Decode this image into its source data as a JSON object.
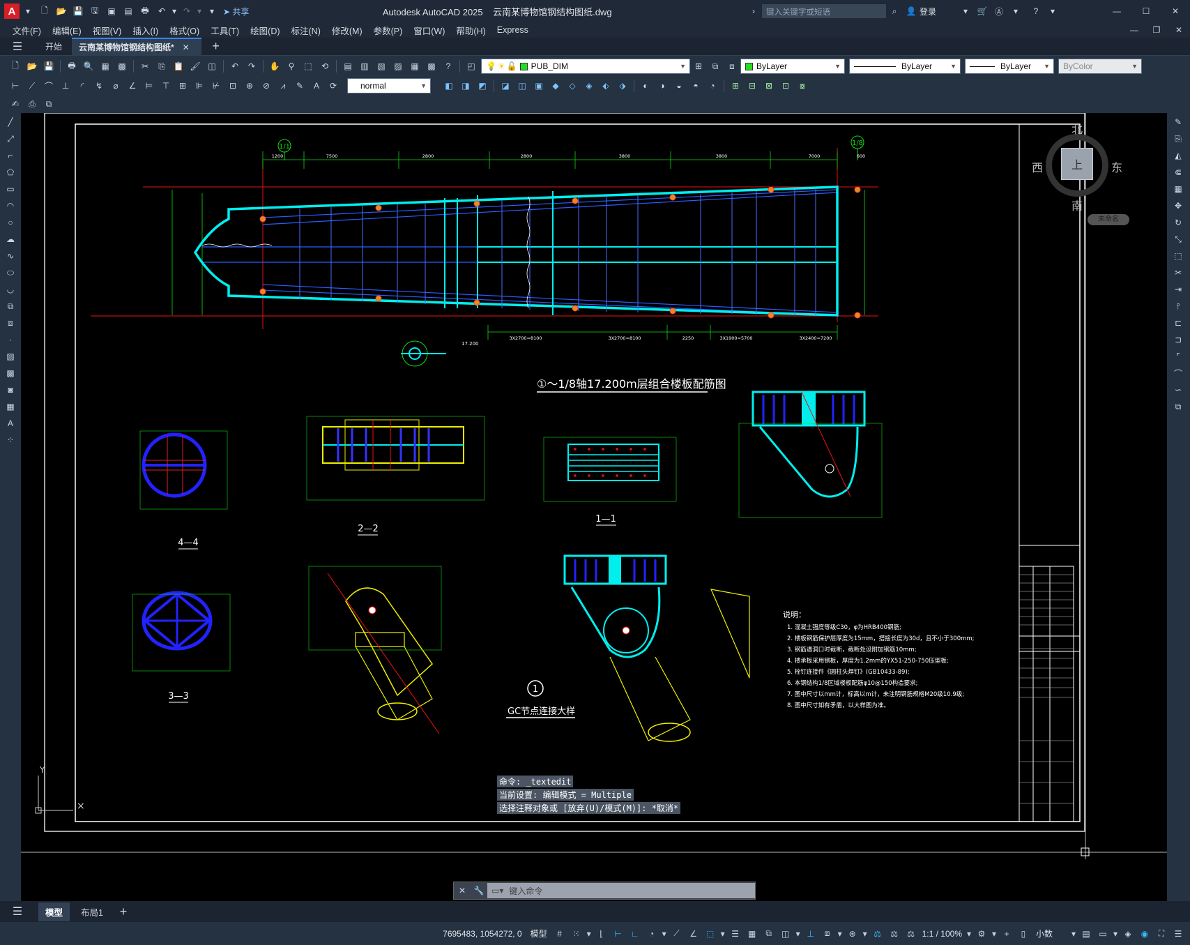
{
  "app": {
    "badge": "A",
    "title": "Autodesk AutoCAD 2025",
    "document": "云南某博物馆钢结构图纸.dwg",
    "share": "共享",
    "search_placeholder": "键入关键字或短语",
    "login": "登录"
  },
  "menu": [
    "文件(F)",
    "编辑(E)",
    "视图(V)",
    "插入(I)",
    "格式(O)",
    "工具(T)",
    "绘图(D)",
    "标注(N)",
    "修改(M)",
    "参数(P)",
    "窗口(W)",
    "帮助(H)",
    "Express"
  ],
  "tabs": {
    "start": "开始",
    "doc": "云南某博物馆钢结构图纸*"
  },
  "toolbar": {
    "layer": "PUB_DIM",
    "color": "ByLayer",
    "linetype": "ByLayer",
    "lineweight": "ByLayer",
    "plotstyle": "ByColor",
    "textstyle": "normal"
  },
  "viewcube": {
    "north": "北",
    "south": "南",
    "east": "东",
    "west": "西",
    "face": "上",
    "ucs": "未命名"
  },
  "drawing": {
    "grid_left": "1/1",
    "grid_right": "1/8",
    "main_title": "①～1/8轴17.200m层组合楼板配筋图",
    "sections": [
      "1—1",
      "2—2",
      "3—3",
      "4—4"
    ],
    "detail_num": "1",
    "detail_title": "GC节点连接大样",
    "notes_title": "说明：",
    "notes": [
      "1. 混凝土强度等级C30，φ为HRB400钢筋;",
      "2. 楼板钢筋保护层厚度为15mm，搭接长度为30d，且不小于300mm;",
      "3. 钢筋遇洞口时截断，截断处设附加钢筋10mm;",
      "4. 楼承板采用钢板，厚度为1.2mm的YX51-250-750压型板;",
      "5. 栓钉连接件《圆柱头焊钉》(GB10433-89);",
      "6. 本钢结构1/8区域楼板配筋φ10@150构造要求;",
      "7. 图中尺寸以mm计，标高以m计，未注明钢筋规格M20级10.9级;",
      "8. 图中尺寸如有矛盾，以大样图为准。"
    ],
    "dims_top": [
      "1200",
      "7500",
      "2800",
      "2800",
      "3800",
      "3800",
      "7000",
      "600"
    ],
    "dims_bottom": [
      "3X2700=8100",
      "3X2700=8100",
      "2250",
      "3X1900=5700",
      "3X2400=7200"
    ],
    "elev": "17.200"
  },
  "command": {
    "line1": "命令: _textedit",
    "line2": "当前设置: 编辑模式 = Multiple",
    "line3": "选择注释对象或 [放弃(U)/模式(M)]: *取消*",
    "placeholder": "键入命令"
  },
  "layouts": {
    "model": "模型",
    "layout1": "布局1"
  },
  "status": {
    "coords": "7695483, 1054272, 0",
    "mode": "模型",
    "scale": "1:1 / 100%",
    "units": "小数"
  }
}
